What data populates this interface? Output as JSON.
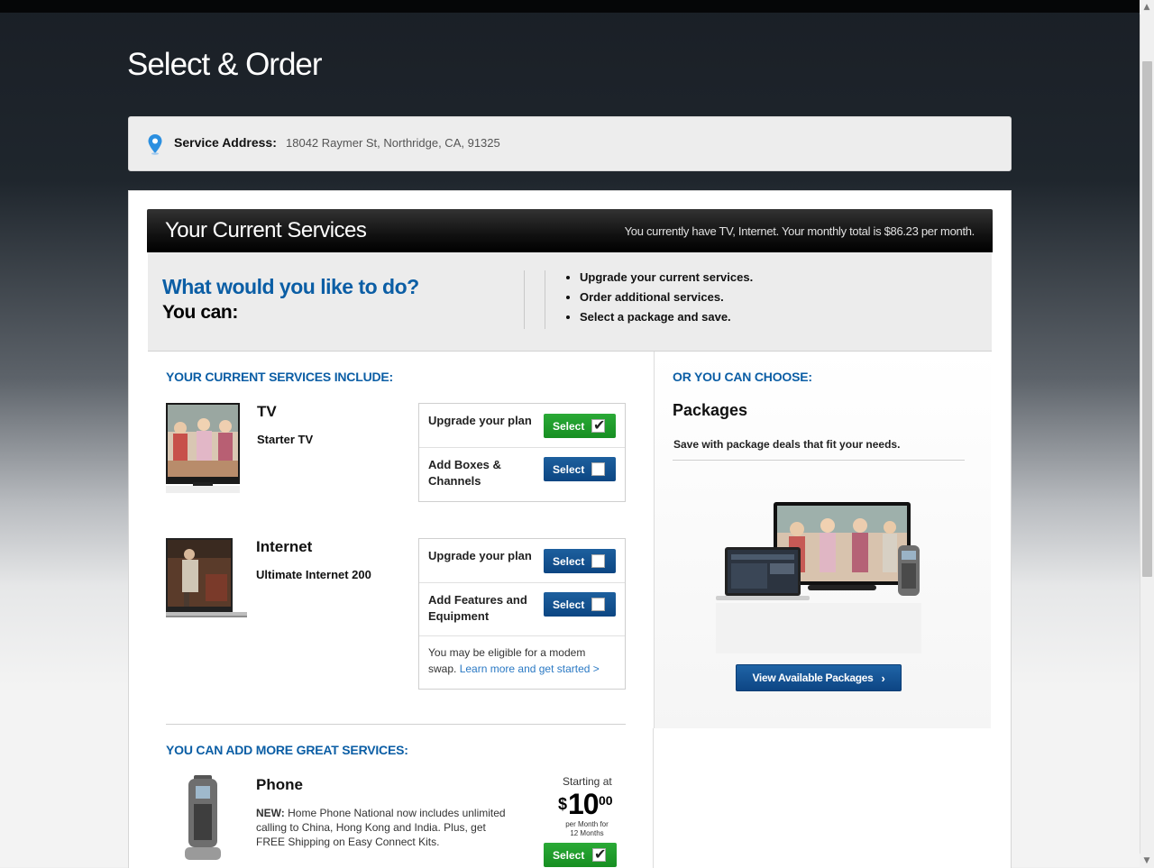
{
  "page": {
    "title": "Select & Order"
  },
  "address": {
    "label": "Service Address:",
    "value": "18042 Raymer St, Northridge, CA, 91325"
  },
  "header": {
    "title": "Your Current Services",
    "summary": "You currently have TV, Internet. Your monthly total is $86.23 per month."
  },
  "intro": {
    "question": "What would you like to do?",
    "you_can": "You can:",
    "options": [
      "Upgrade your current services.",
      "Order additional services.",
      "Select a package and save."
    ]
  },
  "current": {
    "heading": "YOUR CURRENT SERVICES INCLUDE:",
    "tv": {
      "name": "TV",
      "plan": "Starter TV",
      "actions": [
        {
          "label": "Upgrade your plan",
          "button": "Select",
          "state": "checked",
          "color": "#1f9a2b"
        },
        {
          "label": "Add Boxes & Channels",
          "button": "Select",
          "state": "unchecked",
          "color": "#0f4f8f"
        }
      ]
    },
    "internet": {
      "name": "Internet",
      "plan": "Ultimate Internet 200",
      "actions": [
        {
          "label": "Upgrade your plan",
          "button": "Select",
          "state": "unchecked",
          "color": "#0f4f8f"
        },
        {
          "label": "Add Features and Equipment",
          "button": "Select",
          "state": "unchecked",
          "color": "#0f4f8f"
        }
      ],
      "note": "You may be eligible for a modem swap.",
      "note_link": "Learn more and get started >"
    }
  },
  "choose": {
    "heading": "OR YOU CAN CHOOSE:",
    "title": "Packages",
    "desc": "Save with package deals that fit your needs.",
    "button": "View Available Packages"
  },
  "more": {
    "heading": "YOU CAN ADD MORE GREAT SERVICES:",
    "phone": {
      "name": "Phone",
      "new_label": "NEW:",
      "desc": "Home Phone National now includes unlimited calling to China, Hong Kong and India. Plus, get FREE Shipping on Easy Connect Kits.",
      "starting_at": "Starting at",
      "currency": "$",
      "price_main": "10",
      "price_cents": "00",
      "per_month_1": "per Month for",
      "per_month_2": "12 Months",
      "button": "Select"
    }
  },
  "icons": [
    "location-pin-icon",
    "checkmark-icon",
    "chevron-right-icon"
  ],
  "colors": {
    "brand_blue": "#0b5ea5",
    "select_green": "#1f9a2b",
    "select_blue": "#0f4f8f"
  }
}
